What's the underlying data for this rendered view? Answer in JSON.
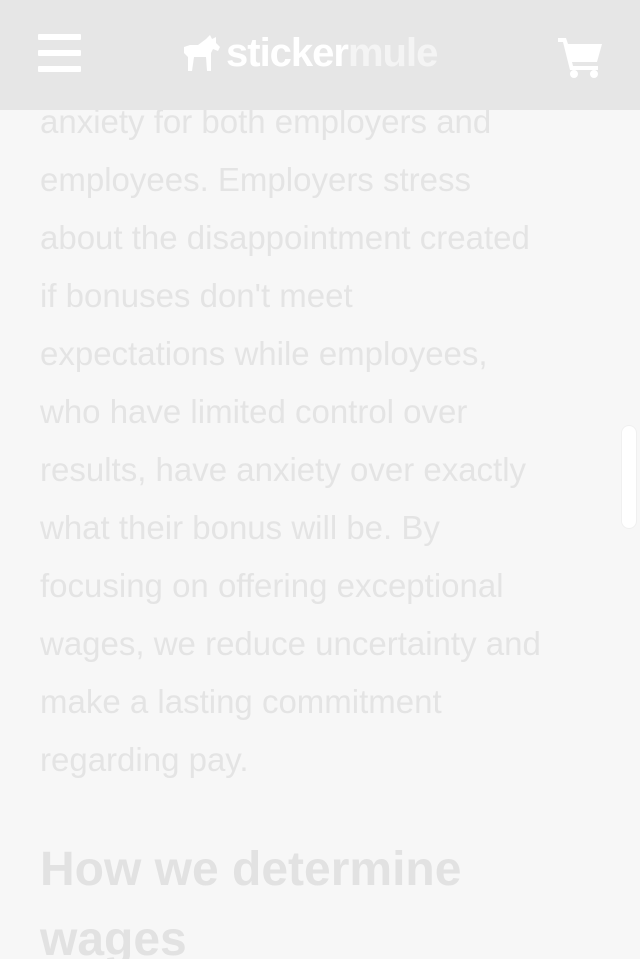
{
  "header": {
    "brand_part1": "sticker",
    "brand_part2": "mule",
    "colors": {
      "background": "#e6e6e6",
      "icon": "#ffffff"
    },
    "icons": [
      "menu-icon",
      "mule-logo-icon",
      "cart-icon"
    ]
  },
  "article": {
    "paragraph": "anxiety for both employers and\nemployees. Employers stress\nabout the disappointment created\nif bonuses don't meet\nexpectations while employees,\nwho have limited control over\nresults, have anxiety over exactly\nwhat their bonus will be. By\nfocusing on offering exceptional\nwages, we reduce uncertainty and\nmake a lasting commitment\nregarding pay.",
    "heading": "How we determine\nwages"
  }
}
